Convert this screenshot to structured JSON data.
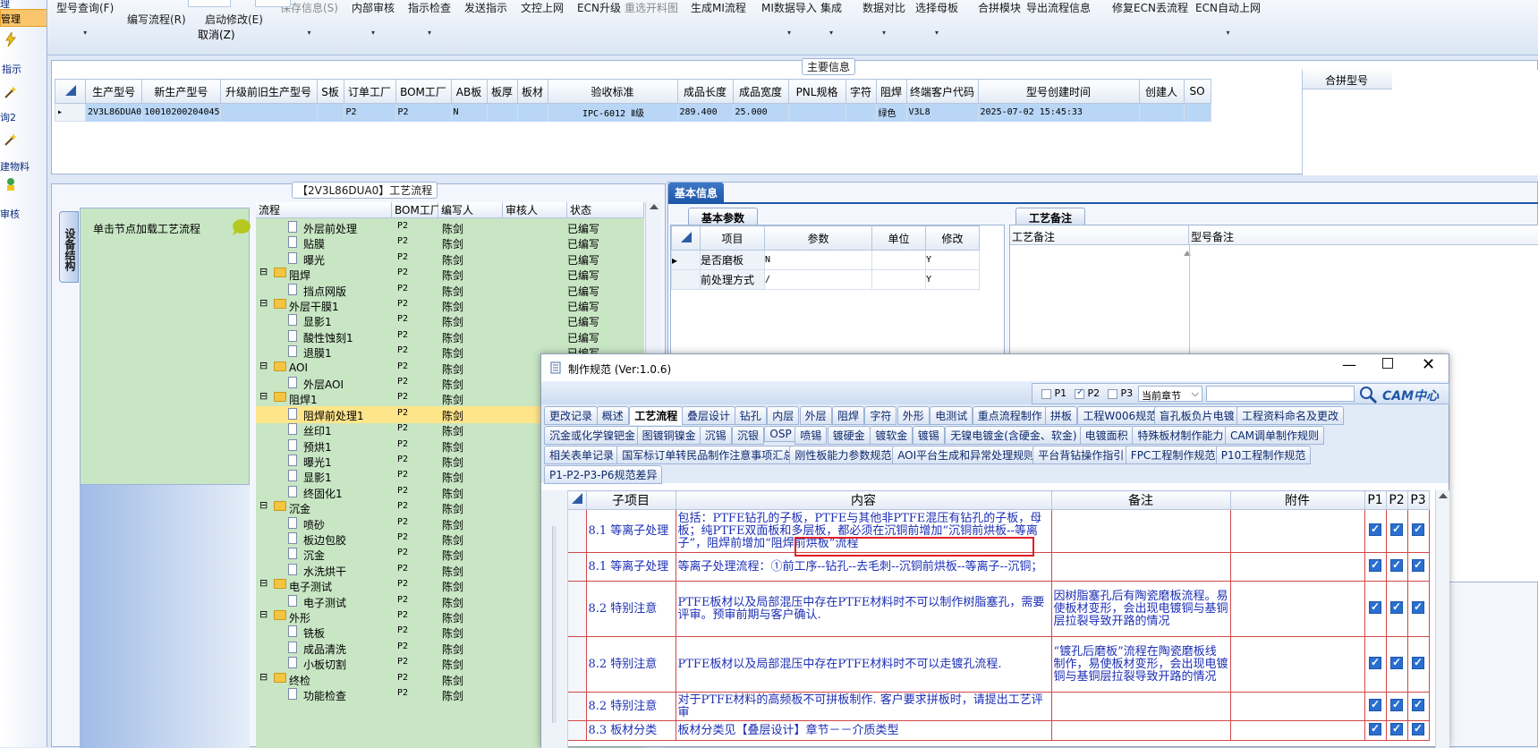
{
  "left_strip": {
    "items": [
      "理",
      "管理",
      "指示",
      "询2",
      "建物料",
      "审核"
    ]
  },
  "toolbar": {
    "buttons": [
      {
        "label": "型号查询(F)",
        "disabled": false,
        "arrow": true
      },
      {
        "label": "编写流程(R)",
        "disabled": false,
        "arrow": false
      },
      {
        "label": "启动修改(E)",
        "disabled": false,
        "arrow": false
      },
      {
        "label": "保存信息(S)",
        "disabled": true,
        "arrow": true
      },
      {
        "label": "内部审核",
        "disabled": false,
        "arrow": true
      },
      {
        "label": "指示检查",
        "disabled": false,
        "arrow": true
      },
      {
        "label": "发送指示",
        "disabled": false,
        "arrow": false
      },
      {
        "label": "文控上网",
        "disabled": false,
        "arrow": false
      },
      {
        "label": "ECN升级",
        "disabled": false,
        "arrow": false
      },
      {
        "label": "重选开料图",
        "disabled": true,
        "arrow": false
      },
      {
        "label": "生成MI流程",
        "disabled": false,
        "arrow": false
      },
      {
        "label": "MI数据导入",
        "disabled": false,
        "arrow": true
      },
      {
        "label": "集成",
        "disabled": false,
        "arrow": true
      },
      {
        "label": "数据对比",
        "disabled": false,
        "arrow": true
      },
      {
        "label": "选择母板",
        "disabled": false,
        "arrow": true
      },
      {
        "label": "合拼模块",
        "disabled": false,
        "arrow": false
      },
      {
        "label": "导出流程信息",
        "disabled": false,
        "arrow": false
      },
      {
        "label": "修复ECN丢流程",
        "disabled": false,
        "arrow": false
      },
      {
        "label": "ECN自动上网",
        "disabled": false,
        "arrow": true
      }
    ],
    "cancel_label": "取消(Z)"
  },
  "main_info": {
    "title": "主要信息",
    "columns": [
      "生产型号",
      "新生产型号",
      "升级前旧生产型号",
      "S板",
      "订单工厂",
      "BOM工厂",
      "AB板",
      "板厚",
      "板材",
      "验收标准",
      "成品长度",
      "成品宽度",
      "PNL规格",
      "字符",
      "阻焊",
      "终端客户代码",
      "型号创建时间",
      "创建人",
      "SO"
    ],
    "row": [
      "2V3L86DUA0",
      "10010200204045",
      "",
      "",
      "P2",
      "P2",
      "N",
      "",
      "",
      "IPC-6012 Ⅱ级",
      "289.400",
      "25.000",
      "",
      "",
      "绿色",
      "V3L8",
      "2025-07-02 15:45:33",
      "",
      ""
    ],
    "side_column": "合拼型号"
  },
  "process_panel": {
    "title": "【2V3L86DUA0】工艺流程",
    "side_tab": "设备结构",
    "load_hint": "单击节点加载工艺流程",
    "columns": [
      "流程",
      "BOM工厂",
      "编写人",
      "审核人",
      "状态"
    ],
    "rows": [
      {
        "indent": 1,
        "type": "doc",
        "name": "外层前处理",
        "bom": "P2",
        "writer": "陈剑",
        "status": "已编写"
      },
      {
        "indent": 1,
        "type": "doc",
        "name": "贴膜",
        "bom": "P2",
        "writer": "陈剑",
        "status": "已编写"
      },
      {
        "indent": 1,
        "type": "doc",
        "name": "曝光",
        "bom": "P2",
        "writer": "陈剑",
        "status": "已编写"
      },
      {
        "indent": 0,
        "type": "folder",
        "name": "阻焊",
        "bom": "P2",
        "writer": "陈剑",
        "status": "已编写"
      },
      {
        "indent": 1,
        "type": "doc",
        "name": "挡点网版",
        "bom": "P2",
        "writer": "陈剑",
        "status": "已编写"
      },
      {
        "indent": 0,
        "type": "folder",
        "name": "外层干膜1",
        "bom": "P2",
        "writer": "陈剑",
        "status": "已编写"
      },
      {
        "indent": 1,
        "type": "doc",
        "name": "显影1",
        "bom": "P2",
        "writer": "陈剑",
        "status": "已编写"
      },
      {
        "indent": 1,
        "type": "doc",
        "name": "酸性蚀刻1",
        "bom": "P2",
        "writer": "陈剑",
        "status": "已编写"
      },
      {
        "indent": 1,
        "type": "doc",
        "name": "退膜1",
        "bom": "P2",
        "writer": "陈剑",
        "status": "已编写"
      },
      {
        "indent": 0,
        "type": "folder",
        "name": "AOI",
        "bom": "P2",
        "writer": "陈剑",
        "status": "已编写"
      },
      {
        "indent": 1,
        "type": "doc",
        "name": "外层AOI",
        "bom": "P2",
        "writer": "陈剑",
        "status": "已编写"
      },
      {
        "indent": 0,
        "type": "folder",
        "name": "阻焊1",
        "bom": "P2",
        "writer": "陈剑",
        "status": "已编写"
      },
      {
        "indent": 1,
        "type": "doc",
        "name": "阻焊前处理1",
        "bom": "P2",
        "writer": "陈剑",
        "status": "已编写",
        "selected": true
      },
      {
        "indent": 1,
        "type": "doc",
        "name": "丝印1",
        "bom": "P2",
        "writer": "陈剑",
        "status": "已编写"
      },
      {
        "indent": 1,
        "type": "doc",
        "name": "预烘1",
        "bom": "P2",
        "writer": "陈剑",
        "status": "已编写"
      },
      {
        "indent": 1,
        "type": "doc",
        "name": "曝光1",
        "bom": "P2",
        "writer": "陈剑",
        "status": "已编写"
      },
      {
        "indent": 1,
        "type": "doc",
        "name": "显影1",
        "bom": "P2",
        "writer": "陈剑",
        "status": "已编写"
      },
      {
        "indent": 1,
        "type": "doc",
        "name": "终固化1",
        "bom": "P2",
        "writer": "陈剑",
        "status": "已编写"
      },
      {
        "indent": 0,
        "type": "folder",
        "name": "沉金",
        "bom": "P2",
        "writer": "陈剑",
        "status": "已编写"
      },
      {
        "indent": 1,
        "type": "doc",
        "name": "喷砂",
        "bom": "P2",
        "writer": "陈剑",
        "status": "已编写"
      },
      {
        "indent": 1,
        "type": "doc",
        "name": "板边包胶",
        "bom": "P2",
        "writer": "陈剑",
        "status": "已编写"
      },
      {
        "indent": 1,
        "type": "doc",
        "name": "沉金",
        "bom": "P2",
        "writer": "陈剑",
        "status": "已编写"
      },
      {
        "indent": 1,
        "type": "doc",
        "name": "水洗烘干",
        "bom": "P2",
        "writer": "陈剑",
        "status": "已编写"
      },
      {
        "indent": 0,
        "type": "folder",
        "name": "电子测试",
        "bom": "P2",
        "writer": "陈剑",
        "status": "已编写"
      },
      {
        "indent": 1,
        "type": "doc",
        "name": "电子测试",
        "bom": "P2",
        "writer": "陈剑",
        "status": "已编写"
      },
      {
        "indent": 0,
        "type": "folder",
        "name": "外形",
        "bom": "P2",
        "writer": "陈剑",
        "status": "已编写"
      },
      {
        "indent": 1,
        "type": "doc",
        "name": "铣板",
        "bom": "P2",
        "writer": "陈剑",
        "status": "已编写"
      },
      {
        "indent": 1,
        "type": "doc",
        "name": "成品清洗",
        "bom": "P2",
        "writer": "陈剑",
        "status": "已编写"
      },
      {
        "indent": 1,
        "type": "doc",
        "name": "小板切割",
        "bom": "P2",
        "writer": "陈剑",
        "status": "已编写"
      },
      {
        "indent": 0,
        "type": "folder",
        "name": "终检",
        "bom": "P2",
        "writer": "陈剑",
        "status": "已编写"
      },
      {
        "indent": 1,
        "type": "doc",
        "name": "功能检查",
        "bom": "P2",
        "writer": "陈剑",
        "status": "已编写"
      }
    ]
  },
  "basic_info": {
    "tab": "基本信息",
    "sub_tab": "基本参数",
    "columns": [
      "项目",
      "参数",
      "单位",
      "修改"
    ],
    "rows": [
      {
        "item": "是否磨板",
        "param": "N",
        "unit": "",
        "modify": "Y"
      },
      {
        "item": "前处理方式",
        "param": "/",
        "unit": "",
        "modify": "Y"
      }
    ],
    "remark_tab": "工艺备注",
    "remark_cols": [
      "工艺备注",
      "型号备注"
    ]
  },
  "dialog": {
    "title": "制作规范 (Ver:1.0.6)",
    "filter": {
      "p1": "P1",
      "p2": "P2",
      "p3": "P3",
      "p1_on": false,
      "p2_on": true,
      "p3_on": false,
      "scope": "当前章节"
    },
    "logo": "CAM中心",
    "tabs_row1": [
      "更改记录",
      "概述",
      "工艺流程",
      "叠层设计",
      "钻孔",
      "内层",
      "外层",
      "阻焊",
      "字符",
      "外形",
      "电测试",
      "重点流程制作",
      "拼板",
      "工程W006规范",
      "盲孔板负片电镀",
      "工程资料命名及更改"
    ],
    "tabs_row2": [
      "沉金或化学镍钯金",
      "图镀铜镍金",
      "沉锡",
      "沉银",
      "OSP",
      "喷锡",
      "镀硬金",
      "镀软金",
      "镀锡",
      "无镍电镀金(含硬金、软金)",
      "电镀面积",
      "特殊板材制作能力",
      "CAM调单制作规则"
    ],
    "tabs_row3": [
      "相关表单记录",
      "国军标订单转民品制作注意事项汇总",
      "刚性板能力参数规范",
      "AOI平台生成和异常处理规则",
      "平台背钻操作指引",
      "FPC工程制作规范",
      "P10工程制作规范"
    ],
    "tabs_row4": [
      "P1-P2-P3-P6规范差异"
    ],
    "active_tab": "工艺流程",
    "columns": [
      "子项目",
      "内容",
      "备注",
      "附件",
      "P1",
      "P2",
      "P3"
    ],
    "rows": [
      {
        "sub": "8.1 等离子处理",
        "content": "包括：PTFE钻孔的子板，PTFE与其他非PTFE混压有钻孔的子板，母板；纯PTFE双面板和多层板，都必须在沉铜前增加“沉铜前烘板--等离子”，阻焊前增加“阻焊前烘板”流程",
        "note": "",
        "attach": "",
        "p1": true,
        "p2": true,
        "p3": true
      },
      {
        "sub": "8.1 等离子处理",
        "content": "等离子处理流程：①前工序--钻孔--去毛刺--沉铜前烘板--等离子--沉铜；",
        "note": "",
        "attach": "",
        "p1": true,
        "p2": true,
        "p3": true
      },
      {
        "sub": "8.2 特别注意",
        "content": "PTFE板材以及局部混压中存在PTFE材料时不可以制作树脂塞孔，需要评审。预审前期与客户确认.",
        "note": "因树脂塞孔后有陶瓷磨板流程。易使板材变形，会出现电镀铜与基铜层拉裂导致开路的情况",
        "attach": "",
        "p1": true,
        "p2": true,
        "p3": true
      },
      {
        "sub": "8.2 特别注意",
        "content": "PTFE板材以及局部混压中存在PTFE材料时不可以走镀孔流程.",
        "note": "“镀孔后磨板”流程在陶瓷磨板线制作，易使板材变形，会出现电镀铜与基铜层拉裂导致开路的情况",
        "attach": "",
        "p1": true,
        "p2": true,
        "p3": true
      },
      {
        "sub": "8.2 特别注意",
        "content": "对于PTFE材料的高频板不可拼板制作. 客户要求拼板时，请提出工艺评审",
        "note": "",
        "attach": "",
        "p1": true,
        "p2": true,
        "p3": true
      },
      {
        "sub": "8.3 板材分类",
        "content": "板材分类见【叠层设计】章节－－介质类型",
        "note": "",
        "attach": "",
        "p1": true,
        "p2": true,
        "p3": true
      }
    ]
  },
  "colors": {
    "accent": "#1d56a8",
    "tree_bg": "#c8e6c4",
    "selection": "#ffe58a",
    "grid_row_sel": "#b9d6f6",
    "spec_text": "#1c2fb5",
    "highlight_box": "#e0202a"
  }
}
